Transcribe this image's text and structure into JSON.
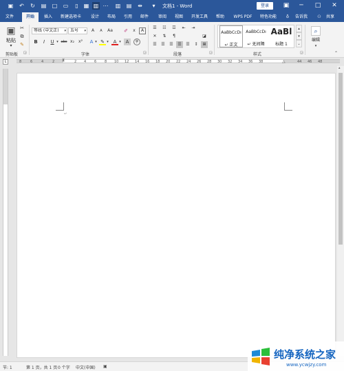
{
  "titlebar": {
    "title": "文档1 - Word",
    "login": "登录"
  },
  "tabs": [
    "文件",
    "开始",
    "插入",
    "新建选项卡",
    "设计",
    "布局",
    "引用",
    "邮件",
    "审阅",
    "视图",
    "开发工具",
    "帮助",
    "WPS PDF",
    "特色功能",
    "告诉我",
    "共享"
  ],
  "ribbon": {
    "clipboard": {
      "paste": "粘贴",
      "label": "剪贴板"
    },
    "font": {
      "name": "等线 (中文正)",
      "size": "五号",
      "label": "字体",
      "aa": "Aa",
      "btn_a": "A",
      "btn_x": "x",
      "bold": "B",
      "italic": "I",
      "underline": "U",
      "strike": "abc",
      "sub": "x₂",
      "sup": "x²"
    },
    "paragraph": {
      "label": "段落"
    },
    "styles": {
      "label": "样式",
      "items": [
        {
          "sample": "AaBbCcDı",
          "name": "↵ 正文"
        },
        {
          "sample": "AaBbCcDı",
          "name": "↵ 无间隔"
        },
        {
          "sample": "AaBl",
          "name": "标题 1"
        }
      ]
    },
    "editing": {
      "label": "编辑"
    }
  },
  "ruler": {
    "h_numbers": [
      "8",
      "6",
      "4",
      "2",
      "",
      "2",
      "4",
      "6",
      "8",
      "10",
      "12",
      "14",
      "16",
      "18",
      "20",
      "22",
      "24",
      "26",
      "28",
      "30",
      "32",
      "34",
      "36",
      "38",
      "",
      "42",
      "44",
      "46",
      "48"
    ]
  },
  "statusbar": {
    "page": "节: 1",
    "pages": "第 1 页，共 1 页",
    "words": "0 个字",
    "lang": "中文(中国)"
  },
  "watermark": {
    "text": "纯净系统之家",
    "url": "www.ycwjzy.com"
  },
  "colors": {
    "brand": "#2b579a",
    "ribbon": "#f3f3f3",
    "highlight": "#ffff00",
    "font_color": "#e02020"
  }
}
